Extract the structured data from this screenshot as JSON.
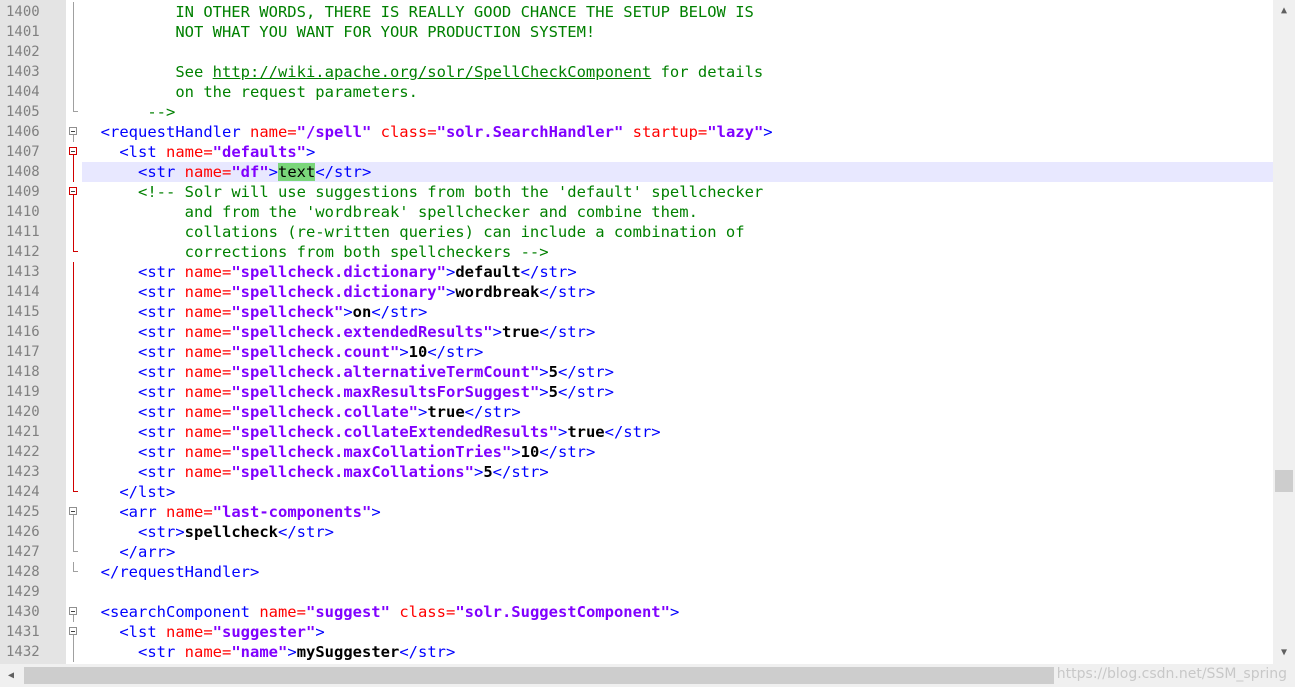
{
  "editor": {
    "current_line": "1408",
    "lines": [
      {
        "n": "1400",
        "fold": "line",
        "code": [
          {
            "t": "          IN OTHER WORDS, THERE IS REALLY GOOD CHANCE THE SETUP BELOW IS",
            "c": "cmt"
          }
        ]
      },
      {
        "n": "1401",
        "fold": "line",
        "code": [
          {
            "t": "          NOT WHAT YOU WANT FOR YOUR PRODUCTION SYSTEM!",
            "c": "cmt"
          }
        ]
      },
      {
        "n": "1402",
        "fold": "line",
        "code": []
      },
      {
        "n": "1403",
        "fold": "line",
        "code": [
          {
            "t": "          See ",
            "c": "cmt"
          },
          {
            "t": "http://wiki.apache.org/solr/SpellCheckComponent",
            "c": "link"
          },
          {
            "t": " for details",
            "c": "cmt"
          }
        ]
      },
      {
        "n": "1404",
        "fold": "line",
        "code": [
          {
            "t": "          on the request parameters.",
            "c": "cmt"
          }
        ]
      },
      {
        "n": "1405",
        "fold": "end",
        "code": [
          {
            "t": "       -->",
            "c": "cmt"
          }
        ]
      },
      {
        "n": "1406",
        "fold": "box",
        "code": [
          {
            "t": "  "
          },
          {
            "t": "<requestHandler ",
            "c": "tag"
          },
          {
            "t": "name=",
            "c": "attr"
          },
          {
            "t": "\"/spell\"",
            "c": "val"
          },
          {
            "t": " class=",
            "c": "attr"
          },
          {
            "t": "\"solr.SearchHandler\"",
            "c": "val"
          },
          {
            "t": " startup=",
            "c": "attr"
          },
          {
            "t": "\"lazy\"",
            "c": "val"
          },
          {
            "t": ">",
            "c": "tag"
          }
        ]
      },
      {
        "n": "1407",
        "fold": "boxred",
        "code": [
          {
            "t": "    "
          },
          {
            "t": "<lst ",
            "c": "tag"
          },
          {
            "t": "name=",
            "c": "attr"
          },
          {
            "t": "\"defaults\"",
            "c": "val"
          },
          {
            "t": ">",
            "c": "tag"
          }
        ]
      },
      {
        "n": "1408",
        "fold": "red",
        "code": [
          {
            "t": "      "
          },
          {
            "t": "<str ",
            "c": "tag"
          },
          {
            "t": "name=",
            "c": "attr"
          },
          {
            "t": "\"df\"",
            "c": "val"
          },
          {
            "t": ">",
            "c": "tag"
          },
          {
            "t": "text",
            "c": "hl"
          },
          {
            "t": "</str>",
            "c": "tag"
          }
        ]
      },
      {
        "n": "1409",
        "fold": "boxred",
        "code": [
          {
            "t": "      "
          },
          {
            "t": "<!-- Solr will use suggestions from both the 'default' spellchecker",
            "c": "cmt"
          }
        ]
      },
      {
        "n": "1410",
        "fold": "red",
        "code": [
          {
            "t": "           and from the 'wordbreak' spellchecker and combine them.",
            "c": "cmt"
          }
        ]
      },
      {
        "n": "1411",
        "fold": "red",
        "code": [
          {
            "t": "           collations (re-written queries) can include a combination of",
            "c": "cmt"
          }
        ]
      },
      {
        "n": "1412",
        "fold": "redend",
        "code": [
          {
            "t": "           corrections from both spellcheckers -->",
            "c": "cmt"
          }
        ]
      },
      {
        "n": "1413",
        "fold": "red",
        "code": [
          {
            "t": "      "
          },
          {
            "t": "<str ",
            "c": "tag"
          },
          {
            "t": "name=",
            "c": "attr"
          },
          {
            "t": "\"spellcheck.dictionary\"",
            "c": "val"
          },
          {
            "t": ">",
            "c": "tag"
          },
          {
            "t": "default",
            "c": "txt"
          },
          {
            "t": "</str>",
            "c": "tag"
          }
        ]
      },
      {
        "n": "1414",
        "fold": "red",
        "code": [
          {
            "t": "      "
          },
          {
            "t": "<str ",
            "c": "tag"
          },
          {
            "t": "name=",
            "c": "attr"
          },
          {
            "t": "\"spellcheck.dictionary\"",
            "c": "val"
          },
          {
            "t": ">",
            "c": "tag"
          },
          {
            "t": "wordbreak",
            "c": "txt"
          },
          {
            "t": "</str>",
            "c": "tag"
          }
        ]
      },
      {
        "n": "1415",
        "fold": "red",
        "code": [
          {
            "t": "      "
          },
          {
            "t": "<str ",
            "c": "tag"
          },
          {
            "t": "name=",
            "c": "attr"
          },
          {
            "t": "\"spellcheck\"",
            "c": "val"
          },
          {
            "t": ">",
            "c": "tag"
          },
          {
            "t": "on",
            "c": "txt"
          },
          {
            "t": "</str>",
            "c": "tag"
          }
        ]
      },
      {
        "n": "1416",
        "fold": "red",
        "code": [
          {
            "t": "      "
          },
          {
            "t": "<str ",
            "c": "tag"
          },
          {
            "t": "name=",
            "c": "attr"
          },
          {
            "t": "\"spellcheck.extendedResults\"",
            "c": "val"
          },
          {
            "t": ">",
            "c": "tag"
          },
          {
            "t": "true",
            "c": "txt"
          },
          {
            "t": "</str>",
            "c": "tag"
          }
        ]
      },
      {
        "n": "1417",
        "fold": "red",
        "code": [
          {
            "t": "      "
          },
          {
            "t": "<str ",
            "c": "tag"
          },
          {
            "t": "name=",
            "c": "attr"
          },
          {
            "t": "\"spellcheck.count\"",
            "c": "val"
          },
          {
            "t": ">",
            "c": "tag"
          },
          {
            "t": "10",
            "c": "txt"
          },
          {
            "t": "</str>",
            "c": "tag"
          }
        ]
      },
      {
        "n": "1418",
        "fold": "red",
        "code": [
          {
            "t": "      "
          },
          {
            "t": "<str ",
            "c": "tag"
          },
          {
            "t": "name=",
            "c": "attr"
          },
          {
            "t": "\"spellcheck.alternativeTermCount\"",
            "c": "val"
          },
          {
            "t": ">",
            "c": "tag"
          },
          {
            "t": "5",
            "c": "txt"
          },
          {
            "t": "</str>",
            "c": "tag"
          }
        ]
      },
      {
        "n": "1419",
        "fold": "red",
        "code": [
          {
            "t": "      "
          },
          {
            "t": "<str ",
            "c": "tag"
          },
          {
            "t": "name=",
            "c": "attr"
          },
          {
            "t": "\"spellcheck.maxResultsForSuggest\"",
            "c": "val"
          },
          {
            "t": ">",
            "c": "tag"
          },
          {
            "t": "5",
            "c": "txt"
          },
          {
            "t": "</str>",
            "c": "tag"
          }
        ]
      },
      {
        "n": "1420",
        "fold": "red",
        "code": [
          {
            "t": "      "
          },
          {
            "t": "<str ",
            "c": "tag"
          },
          {
            "t": "name=",
            "c": "attr"
          },
          {
            "t": "\"spellcheck.collate\"",
            "c": "val"
          },
          {
            "t": ">",
            "c": "tag"
          },
          {
            "t": "true",
            "c": "txt"
          },
          {
            "t": "</str>",
            "c": "tag"
          }
        ]
      },
      {
        "n": "1421",
        "fold": "red",
        "code": [
          {
            "t": "      "
          },
          {
            "t": "<str ",
            "c": "tag"
          },
          {
            "t": "name=",
            "c": "attr"
          },
          {
            "t": "\"spellcheck.collateExtendedResults\"",
            "c": "val"
          },
          {
            "t": ">",
            "c": "tag"
          },
          {
            "t": "true",
            "c": "txt"
          },
          {
            "t": "</str>",
            "c": "tag"
          }
        ]
      },
      {
        "n": "1422",
        "fold": "red",
        "code": [
          {
            "t": "      "
          },
          {
            "t": "<str ",
            "c": "tag"
          },
          {
            "t": "name=",
            "c": "attr"
          },
          {
            "t": "\"spellcheck.maxCollationTries\"",
            "c": "val"
          },
          {
            "t": ">",
            "c": "tag"
          },
          {
            "t": "10",
            "c": "txt"
          },
          {
            "t": "</str>",
            "c": "tag"
          }
        ]
      },
      {
        "n": "1423",
        "fold": "red",
        "code": [
          {
            "t": "      "
          },
          {
            "t": "<str ",
            "c": "tag"
          },
          {
            "t": "name=",
            "c": "attr"
          },
          {
            "t": "\"spellcheck.maxCollations\"",
            "c": "val"
          },
          {
            "t": ">",
            "c": "tag"
          },
          {
            "t": "5",
            "c": "txt"
          },
          {
            "t": "</str>",
            "c": "tag"
          }
        ]
      },
      {
        "n": "1424",
        "fold": "redend",
        "code": [
          {
            "t": "    "
          },
          {
            "t": "</lst>",
            "c": "tag"
          }
        ]
      },
      {
        "n": "1425",
        "fold": "box",
        "code": [
          {
            "t": "    "
          },
          {
            "t": "<arr ",
            "c": "tag"
          },
          {
            "t": "name=",
            "c": "attr"
          },
          {
            "t": "\"last-components\"",
            "c": "val"
          },
          {
            "t": ">",
            "c": "tag"
          }
        ]
      },
      {
        "n": "1426",
        "fold": "line",
        "code": [
          {
            "t": "      "
          },
          {
            "t": "<str>",
            "c": "tag"
          },
          {
            "t": "spellcheck",
            "c": "txt"
          },
          {
            "t": "</str>",
            "c": "tag"
          }
        ]
      },
      {
        "n": "1427",
        "fold": "end",
        "code": [
          {
            "t": "    "
          },
          {
            "t": "</arr>",
            "c": "tag"
          }
        ]
      },
      {
        "n": "1428",
        "fold": "end",
        "code": [
          {
            "t": "  "
          },
          {
            "t": "</requestHandler>",
            "c": "tag"
          }
        ]
      },
      {
        "n": "1429",
        "fold": "none",
        "code": []
      },
      {
        "n": "1430",
        "fold": "box",
        "code": [
          {
            "t": "  "
          },
          {
            "t": "<searchComponent ",
            "c": "tag"
          },
          {
            "t": "name=",
            "c": "attr"
          },
          {
            "t": "\"suggest\"",
            "c": "val"
          },
          {
            "t": " class=",
            "c": "attr"
          },
          {
            "t": "\"solr.SuggestComponent\"",
            "c": "val"
          },
          {
            "t": ">",
            "c": "tag"
          }
        ]
      },
      {
        "n": "1431",
        "fold": "box",
        "code": [
          {
            "t": "    "
          },
          {
            "t": "<lst ",
            "c": "tag"
          },
          {
            "t": "name=",
            "c": "attr"
          },
          {
            "t": "\"suggester\"",
            "c": "val"
          },
          {
            "t": ">",
            "c": "tag"
          }
        ]
      },
      {
        "n": "1432",
        "fold": "line",
        "code": [
          {
            "t": "      "
          },
          {
            "t": "<str ",
            "c": "tag"
          },
          {
            "t": "name=",
            "c": "attr"
          },
          {
            "t": "\"name\"",
            "c": "val"
          },
          {
            "t": ">",
            "c": "tag"
          },
          {
            "t": "mySuggester",
            "c": "txt"
          },
          {
            "t": "</str>",
            "c": "tag"
          }
        ]
      }
    ]
  },
  "scrollbars": {
    "up_icon": "triangle-up-icon",
    "down_icon": "triangle-down-icon",
    "left_icon": "triangle-left-icon",
    "right_icon": "triangle-right-icon",
    "vertical_position": 0.72
  },
  "watermark": "https://blog.csdn.net/SSM_spring"
}
